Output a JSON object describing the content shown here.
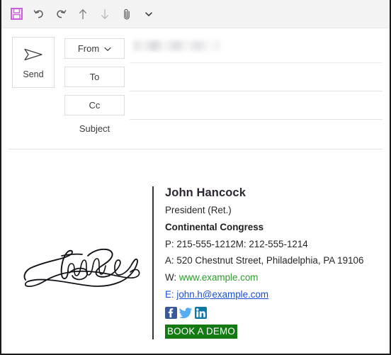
{
  "window": {
    "title": "Email Compose Window",
    "border_color": "#1a1a1a"
  },
  "toolbar": {
    "items": [
      {
        "name": "save-icon",
        "label": "Save",
        "color": "#c860d8"
      },
      {
        "name": "undo-icon",
        "label": "Undo",
        "color": "#5a5a5a"
      },
      {
        "name": "redo-icon",
        "label": "Redo",
        "color": "#5a5a5a"
      },
      {
        "name": "move-up-icon",
        "label": "Previous Item",
        "color": "#7a7a7a"
      },
      {
        "name": "move-down-icon",
        "label": "Next Item",
        "color": "#b4b4b4"
      },
      {
        "name": "attachment-icon",
        "label": "Attach File",
        "color": "#5a5a5a"
      },
      {
        "name": "chevron-down-icon",
        "label": "Customize Quick Access Toolbar",
        "color": "#3b3b3b"
      }
    ],
    "background": "#f3f3f3"
  },
  "compose": {
    "send_button": {
      "label": "Send",
      "icon": "send-paper-plane-icon"
    },
    "fields": [
      {
        "name": "from",
        "label": "From",
        "has_dropdown": true,
        "value": "",
        "redacted": true
      },
      {
        "name": "to",
        "label": "To",
        "has_dropdown": false,
        "value": ""
      },
      {
        "name": "cc",
        "label": "Cc",
        "has_dropdown": false,
        "value": ""
      }
    ],
    "subject_label": "Subject",
    "subject_value": ""
  },
  "signature": {
    "image_alt": "John Hancock handwritten signature",
    "accent_bar_color": "#3b3340",
    "name": "John Hancock",
    "title": "President (Ret.)",
    "organization": "Continental Congress",
    "phone_line": "P: 215-555-1212M: 212-555-1214",
    "address_line": "A: 520 Chestnut Street,  Philadelphia, PA 19106",
    "web_label": "W: ",
    "web_value": "www.example.com",
    "web_color": "#2c9a2c",
    "email_label": "E: ",
    "email_value": "john.h@example.com",
    "email_color": "#1a4fd6",
    "social": [
      {
        "name": "facebook-icon",
        "label": "Facebook",
        "color": "#3b5998"
      },
      {
        "name": "twitter-icon",
        "label": "Twitter",
        "color": "#55acee"
      },
      {
        "name": "linkedin-icon",
        "label": "LinkedIn",
        "color": "#0e76a8"
      }
    ],
    "cta_label": "BOOK A DEMO",
    "cta_background": "#137a13",
    "cta_text_color": "#ffffff"
  }
}
